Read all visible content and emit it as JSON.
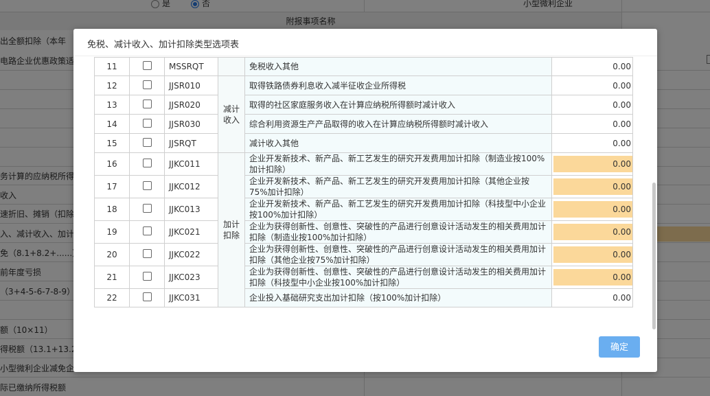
{
  "background": {
    "radio_yes": "是",
    "radio_no": "否",
    "top_right_text": "小型微利企业",
    "header": "附报事项名称",
    "labels": [
      "出全额扣除（本年",
      "电路企业优惠政策适",
      "务计算的应纳税所得",
      "收入",
      "速折旧、摊销（扣除",
      "入、减计收入、加计",
      "免（8.1+8.2+......）",
      "前年度亏损",
      "（3+4-5-6-7-8-9）",
      "额（10×11）",
      "得税额（13.1+13.2",
      "小型微利企业减免企",
      "际已缴纳所得税额"
    ]
  },
  "modal": {
    "title": "免税、减计收入、加计扣除类型选项表",
    "confirm_label": "确定",
    "rows": [
      {
        "no": "11",
        "code": "MSSRQT",
        "desc": "免税收入其他",
        "value": "0.00",
        "highlight": false
      },
      {
        "no": "12",
        "code": "JJSR010",
        "desc": "取得铁路债券利息收入减半征收企业所得税",
        "value": "0.00",
        "highlight": false
      },
      {
        "no": "13",
        "code": "JJSR020",
        "desc": "取得的社区家庭服务收入在计算应纳税所得额时减计收入",
        "value": "0.00",
        "highlight": false
      },
      {
        "no": "14",
        "code": "JJSR030",
        "desc": "综合利用资源生产产品取得的收入在计算应纳税所得额时减计收入",
        "value": "0.00",
        "highlight": false
      },
      {
        "no": "15",
        "code": "JJSRQT",
        "desc": "减计收入其他",
        "value": "0.00",
        "highlight": false
      },
      {
        "no": "16",
        "code": "JJKC011",
        "desc": "企业开发新技术、新产品、新工艺发生的研究开发费用加计扣除（制造业按100%加计扣除）",
        "value": "0.00",
        "highlight": true
      },
      {
        "no": "17",
        "code": "JJKC012",
        "desc": "企业开发新技术、新产品、新工艺发生的研究开发费用加计扣除（其他企业按75%加计扣除）",
        "value": "0.00",
        "highlight": true
      },
      {
        "no": "18",
        "code": "JJKC013",
        "desc": "企业开发新技术、新产品、新工艺发生的研究开发费用加计扣除（科技型中小企业按100%加计扣除）",
        "value": "0.00",
        "highlight": true
      },
      {
        "no": "19",
        "code": "JJKC021",
        "desc": "企业为获得创新性、创意性、突破性的产品进行创意设计活动发生的相关费用加计扣除（制造业按100%加计扣除）",
        "value": "0.00",
        "highlight": true
      },
      {
        "no": "20",
        "code": "JJKC022",
        "desc": "企业为获得创新性、创意性、突破性的产品进行创意设计活动发生的相关费用加计扣除（其他企业按75%加计扣除）",
        "value": "0.00",
        "highlight": true
      },
      {
        "no": "21",
        "code": "JJKC023",
        "desc": "企业为获得创新性、创意性、突破性的产品进行创意设计活动发生的相关费用加计扣除（科技型中小企业按100%加计扣除）",
        "value": "0.00",
        "highlight": true
      },
      {
        "no": "22",
        "code": "JJKC031",
        "desc": "企业投入基础研究支出加计扣除（按100%加计扣除）",
        "value": "0.00",
        "highlight": false
      }
    ],
    "categories": {
      "jjsr": "减计\n收入",
      "jjkc": "加计\n扣除"
    }
  },
  "colors": {
    "highlight": "#fbd89a",
    "button": "#6aaef0",
    "desc_bg": "#f3fbfc"
  }
}
